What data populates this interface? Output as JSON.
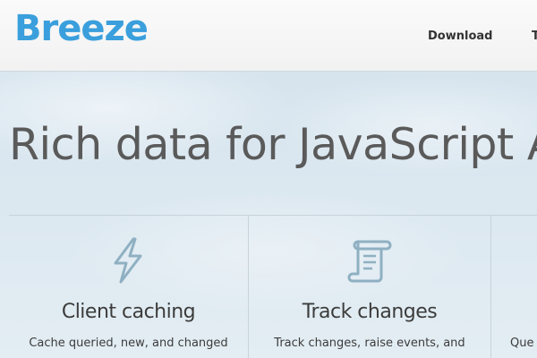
{
  "brand": {
    "logo_text": "Breeze",
    "color": "#3a9fdc"
  },
  "nav": {
    "download": "Download",
    "next_partial": "T"
  },
  "hero": {
    "headline": "Rich data for JavaScript A"
  },
  "features": [
    {
      "icon": "lightning-bolt-icon",
      "title": "Client caching",
      "description": "Cache queried, new, and changed"
    },
    {
      "icon": "scroll-document-icon",
      "title": "Track changes",
      "description": "Track changes, raise events, and"
    },
    {
      "icon": "",
      "title": "",
      "description": "Que"
    }
  ],
  "colors": {
    "icon_stroke": "#8fb0c2",
    "text": "#3c3c3c",
    "headline": "#5a5a5a"
  }
}
